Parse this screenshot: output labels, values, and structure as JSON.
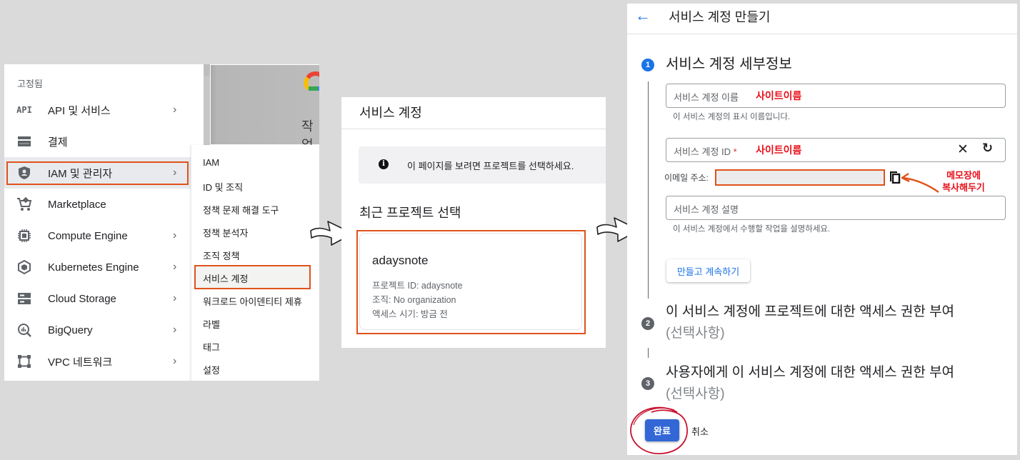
{
  "left_panel": {
    "pinned_label": "고정됨",
    "nav_items": [
      {
        "icon": "api-icon",
        "label": "API 및 서비스",
        "has_submenu": true
      },
      {
        "icon": "billing-icon",
        "label": "결제",
        "has_submenu": false
      },
      {
        "icon": "iam-shield-icon",
        "label": "IAM 및 관리자",
        "has_submenu": true,
        "active": true
      },
      {
        "icon": "marketplace-cart-icon",
        "label": "Marketplace",
        "has_submenu": false
      },
      {
        "icon": "compute-chip-icon",
        "label": "Compute Engine",
        "has_submenu": true
      },
      {
        "icon": "kubernetes-icon",
        "label": "Kubernetes Engine",
        "has_submenu": true
      },
      {
        "icon": "storage-icon",
        "label": "Cloud Storage",
        "has_submenu": true
      },
      {
        "icon": "bigquery-icon",
        "label": "BigQuery",
        "has_submenu": true
      },
      {
        "icon": "vpc-network-icon",
        "label": "VPC 네트워크",
        "has_submenu": true
      }
    ],
    "chevron": "›",
    "background_card_text": "작업",
    "submenu_items": [
      "IAM",
      "ID 및 조직",
      "정책 문제 해결 도구",
      "정책 분석자",
      "조직 정책",
      "서비스 계정",
      "워크로드 아이덴티티 제휴",
      "라벨",
      "태그",
      "설정"
    ],
    "api_icon_text": "API"
  },
  "middle_panel": {
    "title": "서비스 계정",
    "info_icon": "i",
    "info_text": "이 페이지를 보려면 프로젝트를 선택하세요.",
    "recent_heading": "최근 프로젝트 선택",
    "project": {
      "name": "adaysnote",
      "id_line": "프로젝트 ID: adaysnote",
      "org_line": "조직: No organization",
      "access_line": "액세스 시기: 방금 전"
    }
  },
  "right_panel": {
    "back_icon": "←",
    "title": "서비스 계정 만들기",
    "steps": [
      {
        "number": "1",
        "title": "서비스 계정 세부정보",
        "optional": ""
      },
      {
        "number": "2",
        "title": "이 서비스 계정에 프로젝트에 대한 액세스 권한 부여",
        "optional": "(선택사항)"
      },
      {
        "number": "3",
        "title": "사용자에게 이 서비스 계정에 대한 액세스 권한 부여",
        "optional": "(선택사항)"
      }
    ],
    "fields": {
      "name": {
        "label": "서비스 계정 이름",
        "value": "사이트이름",
        "help": "이 서비스 계정의 표시 이름입니다."
      },
      "id": {
        "label": "서비스 계정 ID",
        "required_mark": "*",
        "value": "사이트이름"
      },
      "email": {
        "label": "이메일 주소:",
        "value": ""
      },
      "description": {
        "label": "서비스 계정 설명",
        "value": "",
        "help": "이 서비스 계정에서 수행할 작업을 설명하세요."
      }
    },
    "clear_icon": "✕",
    "refresh_icon": "↻",
    "annotation_line1": "메모장에",
    "annotation_line2": "복사해두기",
    "create_continue_label": "만들고 계속하기",
    "done_label": "완료",
    "cancel_label": "취소"
  },
  "colors": {
    "background": "#dadada",
    "highlight_box": "#e0521b",
    "annotation_red": "#e8101a",
    "accent_blue": "#1a73e8",
    "done_button": "#3367d6"
  }
}
